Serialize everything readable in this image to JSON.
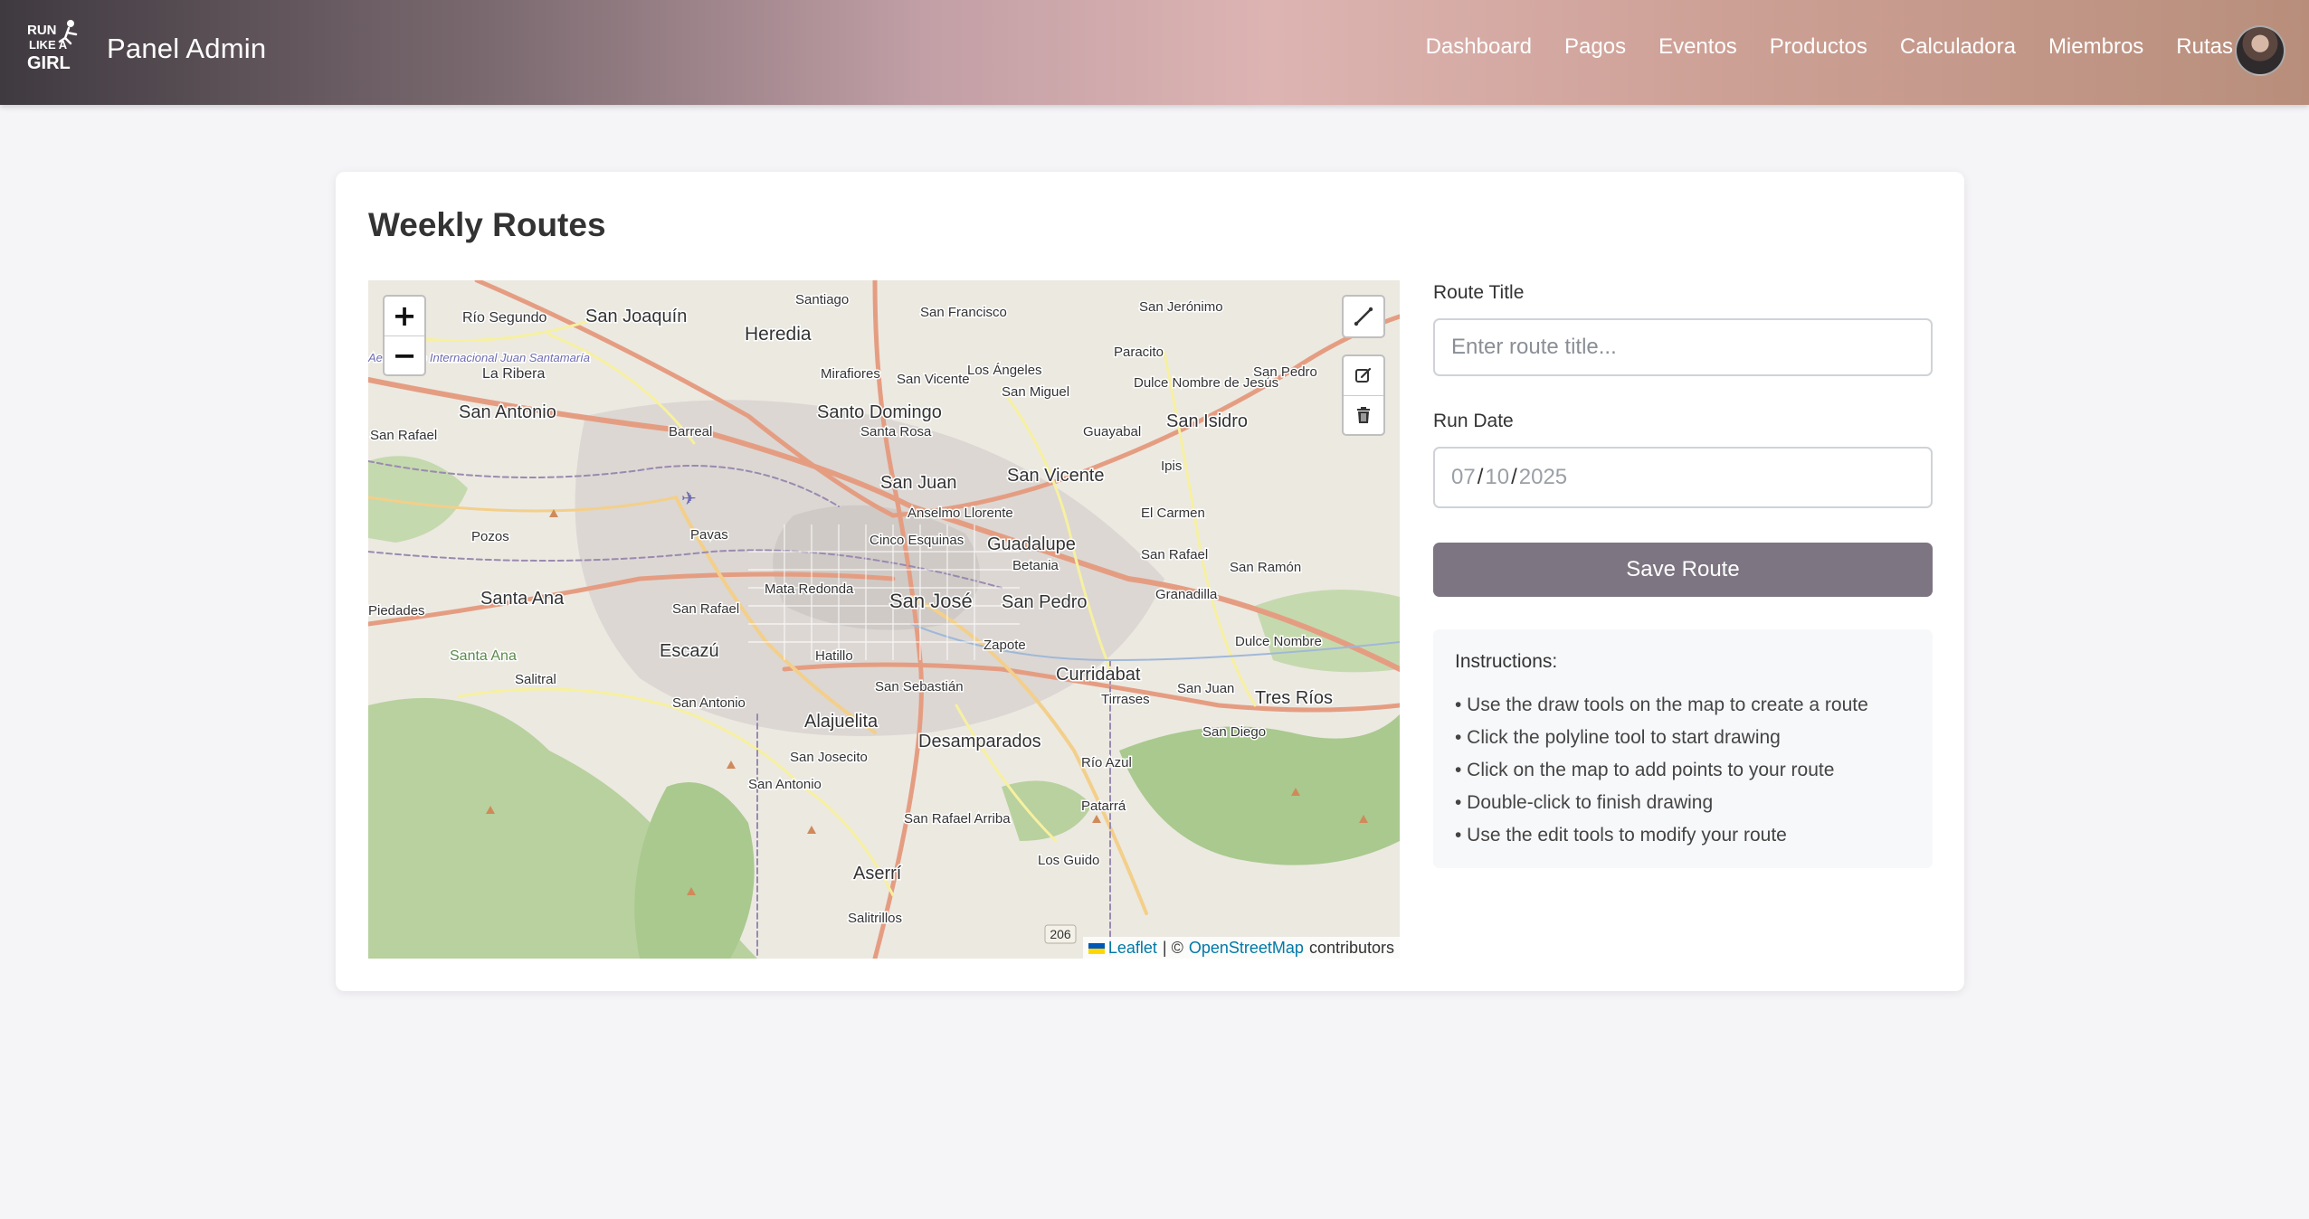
{
  "nav": {
    "brand_logo_text": "RUN LIKE A GIRL",
    "brand_title": "Panel Admin",
    "links": [
      "Dashboard",
      "Pagos",
      "Eventos",
      "Productos",
      "Calculadora",
      "Miembros",
      "Rutas"
    ]
  },
  "card": {
    "title": "Weekly Routes"
  },
  "map": {
    "zoom_in": "+",
    "zoom_out": "−",
    "places": [
      "Río Segundo",
      "San Joaquín",
      "Santiago",
      "Heredia",
      "San Francisco",
      "San Jerónimo",
      "Paracito",
      "La Ribera",
      "Mirafiores",
      "San Vicente",
      "Los Ángeles",
      "San Miguel",
      "Dulce Nombre de Jesús",
      "San Pedro",
      "San Antonio",
      "Santo Domingo",
      "Santa Rosa",
      "Guayabal",
      "San Isidro",
      "San Rafael",
      "Barreal",
      "San Juan",
      "San Vicente",
      "Ipis",
      "El Carmen",
      "Pozos",
      "Pavas",
      "Anselmo Llorente",
      "Cinco Esquinas",
      "Guadalupe",
      "Betania",
      "San Rafael",
      "San Ramón",
      "Santa Ana",
      "Mata Redonda",
      "San José",
      "San Pedro",
      "Granadilla",
      "San Rafael",
      "Escazú",
      "Hatillo",
      "Zapote",
      "Dulce Nombre",
      "Santa Ana",
      "Salitral",
      "Curridabat",
      "San Juan",
      "Tres Ríos",
      "San Antonio",
      "San Sebastián",
      "Tirrases",
      "Alajuelita",
      "Desamparados",
      "San Diego",
      "San Josecito",
      "Río Azul",
      "San Antonio",
      "Patarrá",
      "San Rafael Arriba",
      "Los Guido",
      "Aserrí",
      "Salitrillos",
      "Aeropuerto Internacional Juan Santamaría",
      "Piedades"
    ],
    "road_number": "206",
    "attribution": {
      "leaflet": "Leaflet",
      "separator": "| ©",
      "osm": "OpenStreetMap",
      "suffix": "contributors"
    }
  },
  "form": {
    "route_title_label": "Route Title",
    "route_title_placeholder": "Enter route title...",
    "route_title_value": "",
    "run_date_label": "Run Date",
    "run_date": {
      "month": "07",
      "day": "10",
      "year": "2025"
    },
    "save_label": "Save Route"
  },
  "instructions": {
    "heading": "Instructions:",
    "items": [
      "• Use the draw tools on the map to create a route",
      "• Click the polyline tool to start drawing",
      "• Click on the map to add points to your route",
      "• Double-click to finish drawing",
      "• Use the edit tools to modify your route"
    ]
  },
  "colors": {
    "save_button": "#7d7582",
    "page_bg": "#f5f4f7",
    "link_blue": "#0078a8"
  }
}
